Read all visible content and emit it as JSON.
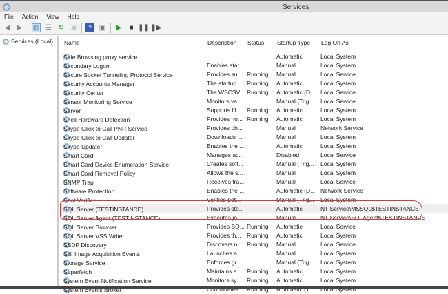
{
  "window": {
    "title": "Services"
  },
  "menu": [
    "File",
    "Action",
    "View",
    "Help"
  ],
  "tree": {
    "root": "Services (Local)"
  },
  "columns": [
    "Name",
    "Description",
    "Status",
    "Startup Type",
    "Log On As"
  ],
  "rows": [
    [
      "Safe Browsing proxy service",
      "",
      "",
      "Automatic",
      "Local System"
    ],
    [
      "Secondary Logon",
      "Enables star...",
      "",
      "Manual",
      "Local System"
    ],
    [
      "Secure Socket Tunneling Protocol Service",
      "Provides su...",
      "Running",
      "Manual",
      "Local Service"
    ],
    [
      "Security Accounts Manager",
      "The startup ...",
      "Running",
      "Automatic",
      "Local System"
    ],
    [
      "Security Center",
      "The WSCSV...",
      "Running",
      "Automatic (D...",
      "Local Service"
    ],
    [
      "Sensor Monitoring Service",
      "Monitors va...",
      "",
      "Manual (Trig...",
      "Local Service"
    ],
    [
      "Server",
      "Supports fil...",
      "Running",
      "Automatic",
      "Local System"
    ],
    [
      "Shell Hardware Detection",
      "Provides no...",
      "Running",
      "Automatic",
      "Local System"
    ],
    [
      "Skype Click to Call PNR Service",
      "Provides ph...",
      "",
      "Manual",
      "Network Service"
    ],
    [
      "Skype Click to Call Updater",
      "Downloads ...",
      "",
      "Manual",
      "Local System"
    ],
    [
      "Skype Updater",
      "Enables the ...",
      "",
      "Automatic",
      "Local System"
    ],
    [
      "Smart Card",
      "Manages ac...",
      "",
      "Disabled",
      "Local Service"
    ],
    [
      "Smart Card Device Enumeration Service",
      "Creates soft...",
      "",
      "Manual (Trig...",
      "Local System"
    ],
    [
      "Smart Card Removal Policy",
      "Allows the s...",
      "",
      "Manual",
      "Local System"
    ],
    [
      "SNMP Trap",
      "Receives tra...",
      "",
      "Manual",
      "Local Service"
    ],
    [
      "Software Protection",
      "Enables the ...",
      "",
      "Automatic (D...",
      "Network Service"
    ],
    [
      "Spot Verifier",
      "Verifies pot...",
      "",
      "Manual (Trig...",
      "Local System"
    ],
    [
      "SQL Server (TESTINSTANCE)",
      "Provides sto...",
      "",
      "Automatic",
      "NT Service\\MSSQL$TESTINSTANCE"
    ],
    [
      "SQL Server Agent (TESTINSTANCE)",
      "Executes jo...",
      "",
      "Manual",
      "NT Service\\SQLAgent$TESTINSTANCE"
    ],
    [
      "SQL Server Browser",
      "Provides SQ...",
      "Running",
      "Automatic",
      "Local Service"
    ],
    [
      "SQL Server VSS Writer",
      "Provides th...",
      "Running",
      "Automatic",
      "Local System"
    ],
    [
      "SSDP Discovery",
      "Discovers n...",
      "Running",
      "Manual",
      "Local Service"
    ],
    [
      "Still Image Acquisition Events",
      "Launches a...",
      "",
      "Manual",
      "Local System"
    ],
    [
      "Storage Service",
      "Enforces gr...",
      "",
      "Manual (Trig...",
      "Local System"
    ],
    [
      "Superfetch",
      "Maintains a...",
      "Running",
      "Automatic",
      "Local System"
    ],
    [
      "System Event Notification Service",
      "Monitors sy...",
      "Running",
      "Automatic",
      "Local System"
    ],
    [
      "System Events Broker",
      "Coordinates...",
      "Running",
      "Automatic (T...",
      "Local System"
    ]
  ],
  "highlight_color": "#d23b3b"
}
